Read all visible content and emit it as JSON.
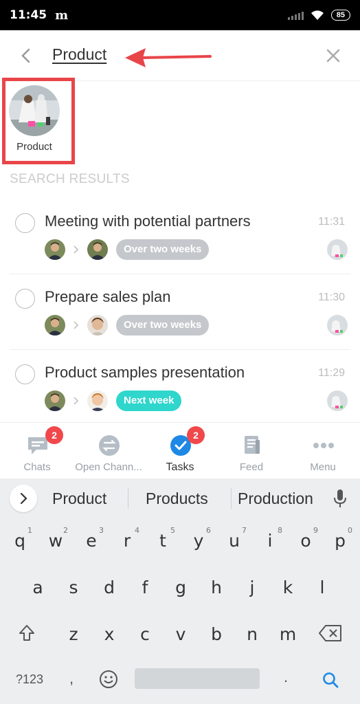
{
  "status_bar": {
    "time": "11:45",
    "app_glyph": "m",
    "battery": "85"
  },
  "search": {
    "query": "Product",
    "back_icon": "chevron-left-icon",
    "clear_icon": "close-icon"
  },
  "top_result": {
    "label": "Product"
  },
  "section_title": "SEARCH RESULTS",
  "tasks": [
    {
      "title": "Meeting with potential partners",
      "time": "11:31",
      "deadline": "Over two weeks",
      "deadline_style": "grey"
    },
    {
      "title": "Prepare sales plan",
      "time": "11:30",
      "deadline": "Over two weeks",
      "deadline_style": "grey"
    },
    {
      "title": "Product samples presentation",
      "time": "11:29",
      "deadline": "Next week",
      "deadline_style": "teal"
    }
  ],
  "bottom_nav": [
    {
      "label": "Chats",
      "badge": "2",
      "icon": "chat-bubble-icon"
    },
    {
      "label": "Open Chann...",
      "icon": "open-channels-icon"
    },
    {
      "label": "Tasks",
      "badge": "2",
      "icon": "checkmark-circle-icon",
      "active": true
    },
    {
      "label": "Feed",
      "icon": "feed-icon"
    },
    {
      "label": "Menu",
      "icon": "more-dots-icon"
    }
  ],
  "keyboard": {
    "suggestions": [
      "Product",
      "Products",
      "Production"
    ],
    "row1": [
      "q",
      "w",
      "e",
      "r",
      "t",
      "y",
      "u",
      "i",
      "o",
      "p"
    ],
    "row1_hints": [
      "1",
      "2",
      "3",
      "4",
      "5",
      "6",
      "7",
      "8",
      "9",
      "0"
    ],
    "row2": [
      "a",
      "s",
      "d",
      "f",
      "g",
      "h",
      "j",
      "k",
      "l"
    ],
    "row3": [
      "z",
      "x",
      "c",
      "v",
      "b",
      "n",
      "m"
    ],
    "symbols_label": "?123",
    "comma": ",",
    "period": "."
  },
  "colors": {
    "badge": "#f0484b",
    "active_tab": "#1e88e5",
    "teal_pill": "#2fd6cc",
    "grey_pill": "#c4c7cb",
    "highlight": "#e84549",
    "arrow": "#e84549"
  }
}
